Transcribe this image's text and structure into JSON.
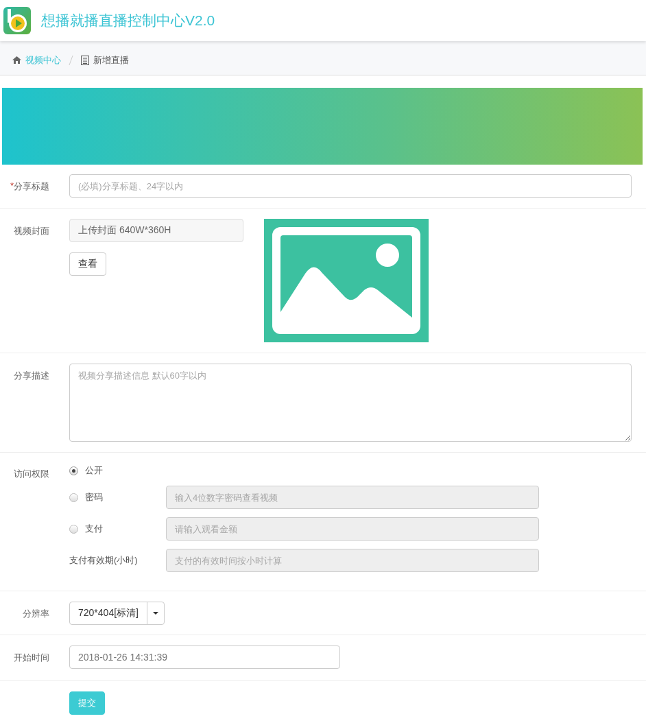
{
  "header": {
    "title": "想播就播直播控制中心V2.0"
  },
  "breadcrumb": [
    {
      "label": "视频中心",
      "kind": "link"
    },
    {
      "label": "新增直播",
      "kind": "current"
    }
  ],
  "form": {
    "title_field": {
      "required_mark": "*",
      "label": "分享标题",
      "placeholder": "(必填)分享标题、24字以内"
    },
    "cover": {
      "label": "视频封面",
      "upload_label": "上传封面 640W*360H",
      "view_button": "查看"
    },
    "description": {
      "label": "分享描述",
      "placeholder": "视频分享描述信息 默认60字以内"
    },
    "access": {
      "label": "访问权限",
      "options": [
        {
          "label": "公开",
          "selected": true
        },
        {
          "label": "密码",
          "selected": false,
          "input": {
            "placeholder": "输入4位数字密码查看视频",
            "disabled": true
          }
        },
        {
          "label": "支付",
          "selected": false,
          "input": {
            "placeholder": "请输入观看金额",
            "disabled": true
          }
        }
      ],
      "validity": {
        "label": "支付有效期(小时)",
        "input": {
          "placeholder": "支付的有效时间按小时计算",
          "disabled": true
        }
      }
    },
    "resolution": {
      "label": "分辨率",
      "value": "720*404[标清]"
    },
    "start_time": {
      "label": "开始时间",
      "value": "2018-01-26 14:31:39"
    },
    "submit": "提交"
  }
}
